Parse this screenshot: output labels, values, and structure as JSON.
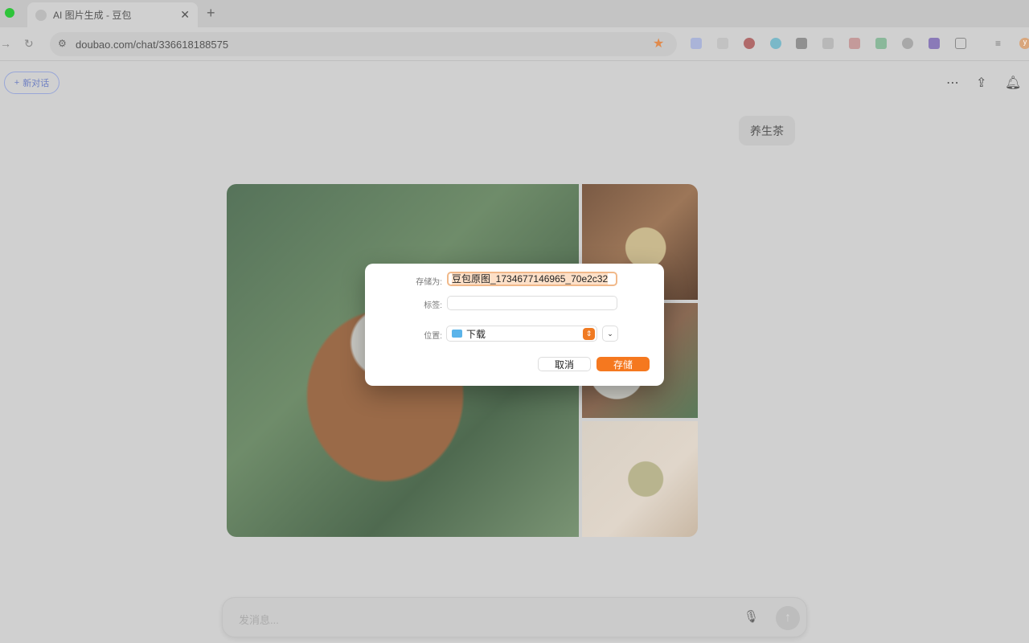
{
  "browser": {
    "tab_title": "AI 图片生成 - 豆包",
    "url": "doubao.com/chat/336618188575",
    "avatar_initial": "y"
  },
  "header": {
    "new_chat": "新对话"
  },
  "chat": {
    "user_message": "养生茶",
    "input_placeholder": "发消息..."
  },
  "dialog": {
    "save_as_label": "存储为:",
    "filename": "豆包原图_1734677146965_70e2c32",
    "tags_label": "标签:",
    "tags_value": "",
    "location_label": "位置:",
    "location_value": "下载",
    "cancel": "取消",
    "save": "存储"
  },
  "colors": {
    "accent": "#f5781f",
    "overlay_bg": "#d0d0d0"
  }
}
